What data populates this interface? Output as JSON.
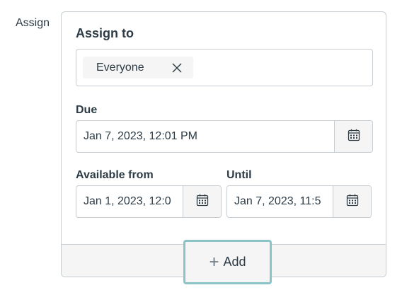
{
  "side_label": "Assign",
  "assign_to": {
    "title": "Assign to",
    "chips": [
      {
        "label": "Everyone"
      }
    ]
  },
  "due": {
    "label": "Due",
    "value": "Jan 7, 2023, 12:01 PM"
  },
  "available_from": {
    "label": "Available from",
    "value": "Jan 1, 2023, 12:0"
  },
  "until": {
    "label": "Until",
    "value": "Jan 7, 2023, 11:5"
  },
  "add_button": {
    "label": "Add"
  },
  "colors": {
    "text": "#2d3b45",
    "border": "#c7cdd1",
    "muted_bg": "#f5f5f5",
    "focus_ring": "#8bc3c6"
  },
  "icons": {
    "remove_chip": "close-icon",
    "date_picker": "calendar-icon",
    "add": "plus-icon"
  }
}
